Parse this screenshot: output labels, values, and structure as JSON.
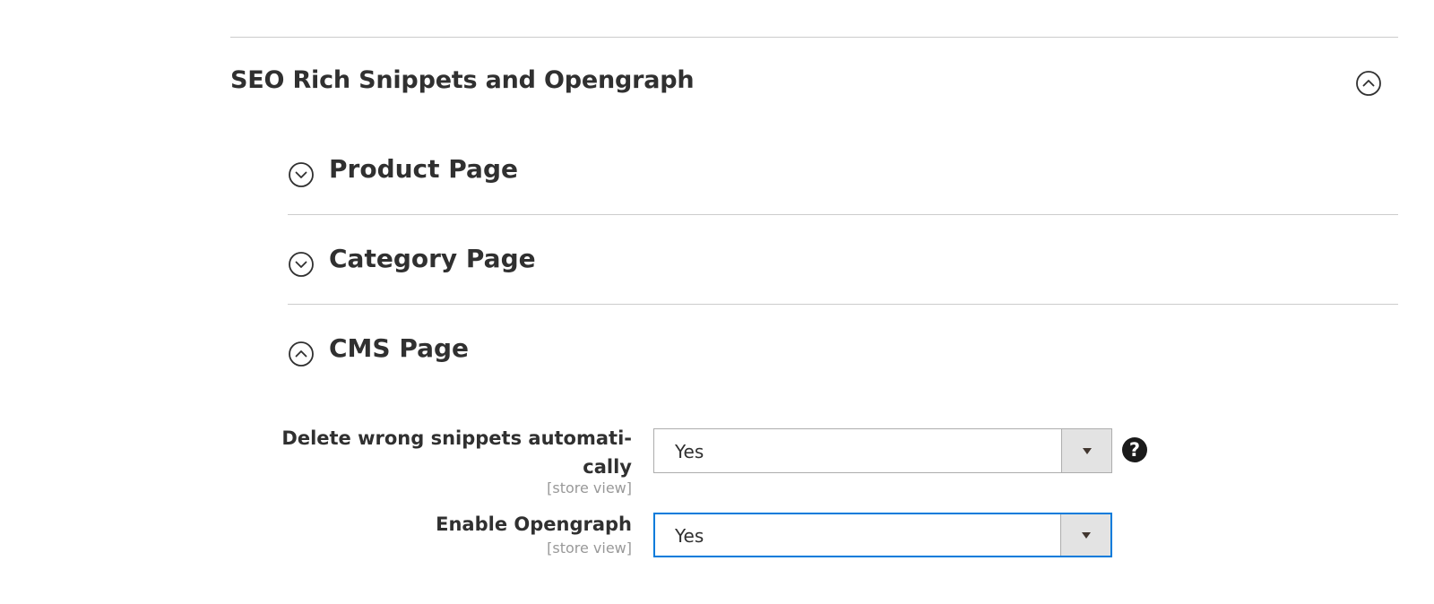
{
  "section": {
    "title": "SEO Rich Snippets and Opengraph",
    "toggle_icon": "chevron-up-circle-icon"
  },
  "groups": [
    {
      "title": "Product Page",
      "toggle_icon": "chevron-down-circle-icon",
      "expanded": false
    },
    {
      "title": "Category Page",
      "toggle_icon": "chevron-down-circle-icon",
      "expanded": false
    },
    {
      "title": "CMS Page",
      "toggle_icon": "chevron-up-circle-icon",
      "expanded": true
    }
  ],
  "fields": [
    {
      "label_line1": "Delete wrong snippets automati-",
      "label_line2": "cally",
      "scope": "[store view]",
      "value": "Yes",
      "has_help": true,
      "help_icon": "question-circle-icon"
    },
    {
      "label_line1": "Enable Opengraph",
      "scope": "[store view]",
      "value": "Yes",
      "focused": true
    }
  ],
  "colors": {
    "focus_border": "#007bdb",
    "text": "#303030",
    "scope_text": "#999999",
    "arrow_bg": "#e3e3e3"
  }
}
